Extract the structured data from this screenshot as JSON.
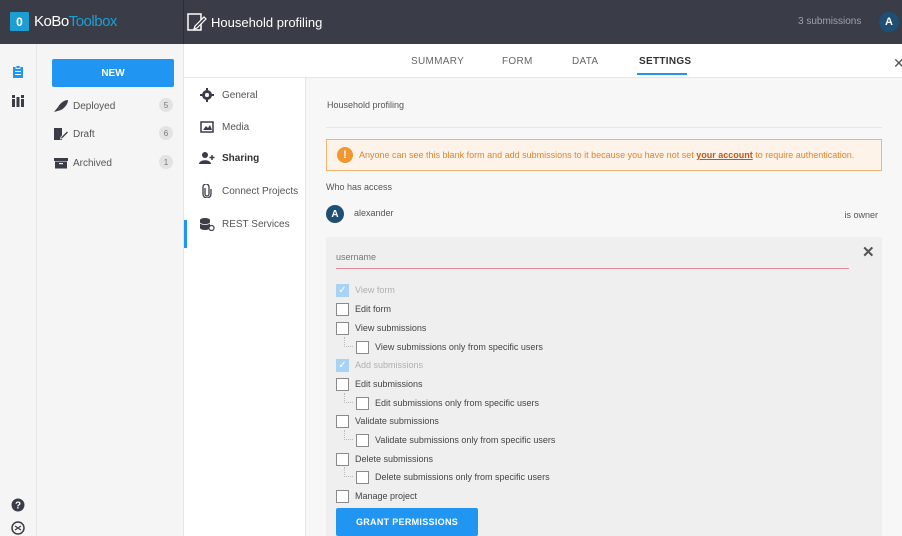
{
  "brand": {
    "box": "0",
    "text_dark": "KoBo",
    "text_light": "Toolbox"
  },
  "project": {
    "title": "Household profiling"
  },
  "header": {
    "submissions": "3 submissions",
    "avatar": "A"
  },
  "sidebar": {
    "new_label": "NEW",
    "items": [
      {
        "label": "Deployed",
        "count": "5"
      },
      {
        "label": "Draft",
        "count": "6"
      },
      {
        "label": "Archived",
        "count": "1"
      }
    ]
  },
  "tabs": [
    "SUMMARY",
    "FORM",
    "DATA",
    "SETTINGS"
  ],
  "active_tab": "SETTINGS",
  "subnav": [
    {
      "label": "General",
      "icon": "gear-icon"
    },
    {
      "label": "Media",
      "icon": "image-icon"
    },
    {
      "label": "Sharing",
      "icon": "add-user-icon"
    },
    {
      "label": "Connect Projects",
      "icon": "paperclip-icon"
    },
    {
      "label": "REST Services",
      "icon": "database-icon"
    }
  ],
  "main": {
    "breadcrumb": "Household profiling",
    "warning": {
      "before": "Anyone can see this blank form and add submissions to it because you have not set ",
      "link": "your account",
      "after": " to require authentication."
    },
    "who_has_access": "Who has access",
    "owner": {
      "avatar": "A",
      "name": "alexander",
      "role": "is owner"
    },
    "form": {
      "username_placeholder": "username",
      "permissions": [
        {
          "label": "View form",
          "checked": true,
          "disabled": true
        },
        {
          "label": "Edit form",
          "checked": false,
          "disabled": false
        },
        {
          "label": "View submissions",
          "checked": false,
          "disabled": false
        },
        {
          "label": "View submissions only from specific users",
          "checked": false,
          "disabled": false
        },
        {
          "label": "Add submissions",
          "checked": true,
          "disabled": true
        },
        {
          "label": "Edit submissions",
          "checked": false,
          "disabled": false
        },
        {
          "label": "Edit submissions only from specific users",
          "checked": false,
          "disabled": false
        },
        {
          "label": "Validate submissions",
          "checked": false,
          "disabled": false
        },
        {
          "label": "Validate submissions only from specific users",
          "checked": false,
          "disabled": false
        },
        {
          "label": "Delete submissions",
          "checked": false,
          "disabled": false
        },
        {
          "label": "Delete submissions only from specific users",
          "checked": false,
          "disabled": false
        },
        {
          "label": "Manage project",
          "checked": false,
          "disabled": false
        }
      ],
      "grant_label": "GRANT PERMISSIONS"
    }
  },
  "colors": {
    "accent": "#2095f2",
    "topbar": "#3a3d47",
    "warning": "#f19631"
  }
}
